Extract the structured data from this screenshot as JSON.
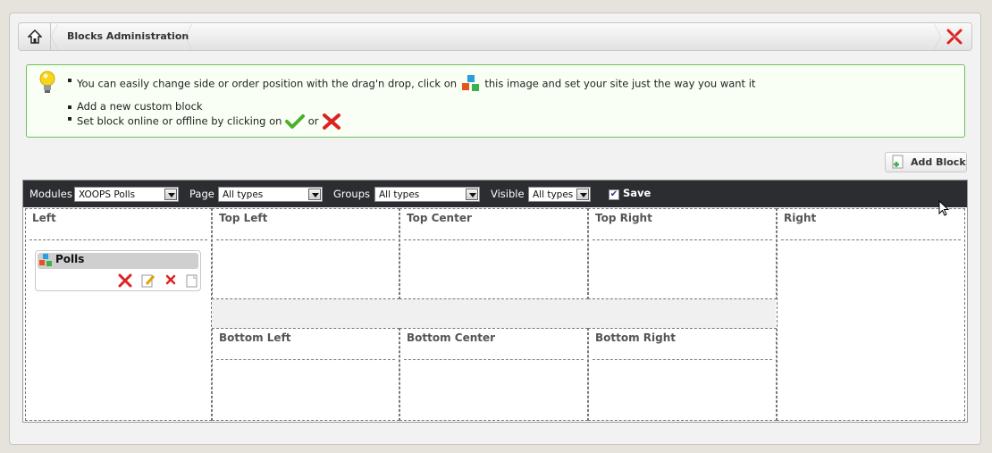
{
  "breadcrumb": {
    "home_icon": "home-icon",
    "title": "Blocks Administration",
    "close_icon": "xoops-close-icon"
  },
  "tips": {
    "line1_a": "You can easily change side or order position with the drag'n drop, click on",
    "line1_b": "this image and set your site just the way you want it",
    "line2": "Add a new custom block",
    "line3_a": "Set block online or offline by clicking on",
    "line3_or": "or"
  },
  "add_block_label": "Add Block",
  "filter": {
    "modules_label": "Modules",
    "modules_value": "XOOPS Polls",
    "page_label": "Page",
    "page_value": "All types",
    "groups_label": "Groups",
    "groups_value": "All types",
    "visible_label": "Visible",
    "visible_value": "All types",
    "save_label": "Save",
    "save_checked": true
  },
  "zones": {
    "left": "Left",
    "top_left": "Top Left",
    "top_center": "Top Center",
    "top_right": "Top Right",
    "right": "Right",
    "bottom_left": "Bottom Left",
    "bottom_center": "Bottom Center",
    "bottom_right": "Bottom Right"
  },
  "block_item": {
    "title": "Polls"
  },
  "colors": {
    "toolbar_bg": "#2b2d30",
    "tips_border": "#6bbf5a",
    "delete_red": "#d22",
    "online_green": "#4caf2a"
  }
}
